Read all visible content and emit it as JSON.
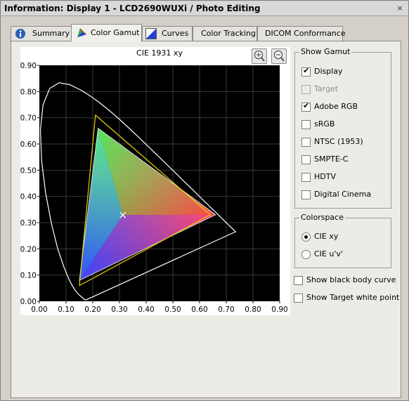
{
  "window": {
    "title": "Information: Display 1 - LCD2690WUXi / Photo Editing",
    "close_glyph": "×"
  },
  "tabs": [
    {
      "label": "Summary",
      "icon": "info-icon"
    },
    {
      "label": "Color Gamut",
      "icon": "color-gamut-icon",
      "active": true
    },
    {
      "label": "Curves",
      "icon": "curves-icon"
    },
    {
      "label": "Color Tracking"
    },
    {
      "label": "DICOM Conformance"
    }
  ],
  "chart_data": {
    "type": "scatter",
    "title": "CIE 1931 xy",
    "xlim": [
      0,
      0.9
    ],
    "ylim": [
      0,
      0.9
    ],
    "x_ticks": [
      "0.00",
      "0.10",
      "0.20",
      "0.30",
      "0.40",
      "0.50",
      "0.60",
      "0.70",
      "0.80",
      "0.90"
    ],
    "y_ticks": [
      "0.00",
      "0.10",
      "0.20",
      "0.30",
      "0.40",
      "0.50",
      "0.60",
      "0.70",
      "0.80",
      "0.90"
    ],
    "grid": true,
    "background": "#000000",
    "spectral_locus": [
      [
        0.1741,
        0.005
      ],
      [
        0.1738,
        0.0049
      ],
      [
        0.1736,
        0.0049
      ],
      [
        0.1733,
        0.0048
      ],
      [
        0.173,
        0.0048
      ],
      [
        0.1726,
        0.0048
      ],
      [
        0.1721,
        0.0048
      ],
      [
        0.1714,
        0.0051
      ],
      [
        0.1703,
        0.0058
      ],
      [
        0.1689,
        0.0069
      ],
      [
        0.1669,
        0.0086
      ],
      [
        0.1644,
        0.0109
      ],
      [
        0.1611,
        0.0138
      ],
      [
        0.1566,
        0.0177
      ],
      [
        0.151,
        0.0227
      ],
      [
        0.144,
        0.0297
      ],
      [
        0.1355,
        0.0399
      ],
      [
        0.1241,
        0.0578
      ],
      [
        0.1096,
        0.0868
      ],
      [
        0.0913,
        0.1327
      ],
      [
        0.0687,
        0.2007
      ],
      [
        0.0454,
        0.295
      ],
      [
        0.0235,
        0.4127
      ],
      [
        0.0082,
        0.5384
      ],
      [
        0.0039,
        0.6548
      ],
      [
        0.0139,
        0.7502
      ],
      [
        0.0389,
        0.812
      ],
      [
        0.0743,
        0.8338
      ],
      [
        0.1142,
        0.8262
      ],
      [
        0.1547,
        0.8059
      ],
      [
        0.1929,
        0.7816
      ],
      [
        0.2296,
        0.7543
      ],
      [
        0.2658,
        0.7243
      ],
      [
        0.3016,
        0.6923
      ],
      [
        0.3373,
        0.6589
      ],
      [
        0.3731,
        0.6245
      ],
      [
        0.4087,
        0.5896
      ],
      [
        0.4441,
        0.5547
      ],
      [
        0.4788,
        0.5202
      ],
      [
        0.5125,
        0.4866
      ],
      [
        0.5448,
        0.4544
      ],
      [
        0.5752,
        0.4242
      ],
      [
        0.6029,
        0.3965
      ],
      [
        0.627,
        0.3725
      ],
      [
        0.6482,
        0.3514
      ],
      [
        0.6658,
        0.334
      ],
      [
        0.6801,
        0.3197
      ],
      [
        0.6915,
        0.3083
      ],
      [
        0.7006,
        0.2993
      ],
      [
        0.7079,
        0.292
      ],
      [
        0.714,
        0.2859
      ],
      [
        0.719,
        0.2809
      ],
      [
        0.723,
        0.277
      ],
      [
        0.726,
        0.274
      ],
      [
        0.7283,
        0.2717
      ],
      [
        0.73,
        0.27
      ],
      [
        0.7311,
        0.2689
      ],
      [
        0.732,
        0.268
      ],
      [
        0.7327,
        0.2673
      ],
      [
        0.7334,
        0.2666
      ],
      [
        0.734,
        0.266
      ],
      [
        0.7344,
        0.2656
      ],
      [
        0.7346,
        0.2654
      ],
      [
        0.7347,
        0.2653
      ]
    ],
    "display_gamut": {
      "red": [
        0.66,
        0.33
      ],
      "green": [
        0.22,
        0.66
      ],
      "blue": [
        0.15,
        0.08
      ]
    },
    "adobe_rgb_gamut": {
      "red": [
        0.64,
        0.33
      ],
      "green": [
        0.21,
        0.71
      ],
      "blue": [
        0.15,
        0.06
      ]
    },
    "white_point": [
      0.3127,
      0.329
    ],
    "locus_color": "#ffffff",
    "adobe_color": "#e6d200",
    "white_point_color": "#ffffff"
  },
  "zoom": {
    "zoom_in_icon": "zoom-in-icon",
    "zoom_out_icon": "zoom-out-icon"
  },
  "show_gamut": {
    "title": "Show Gamut",
    "items": [
      {
        "label": "Display",
        "checked": true,
        "enabled": true
      },
      {
        "label": "Target",
        "checked": false,
        "enabled": false
      },
      {
        "label": "Adobe RGB",
        "checked": true,
        "enabled": true
      },
      {
        "label": "sRGB",
        "checked": false,
        "enabled": true
      },
      {
        "label": "NTSC (1953)",
        "checked": false,
        "enabled": true
      },
      {
        "label": "SMPTE-C",
        "checked": false,
        "enabled": true
      },
      {
        "label": "HDTV",
        "checked": false,
        "enabled": true
      },
      {
        "label": "Digital Cinema",
        "checked": false,
        "enabled": true
      }
    ]
  },
  "colorspace": {
    "title": "Colorspace",
    "options": [
      {
        "label": "CIE xy",
        "selected": true
      },
      {
        "label": "CIE u'v'",
        "selected": false
      }
    ]
  },
  "options": [
    {
      "label": "Show black body curve",
      "checked": false
    },
    {
      "label": "Show Target white point",
      "checked": false
    }
  ],
  "check_glyph": "✔"
}
